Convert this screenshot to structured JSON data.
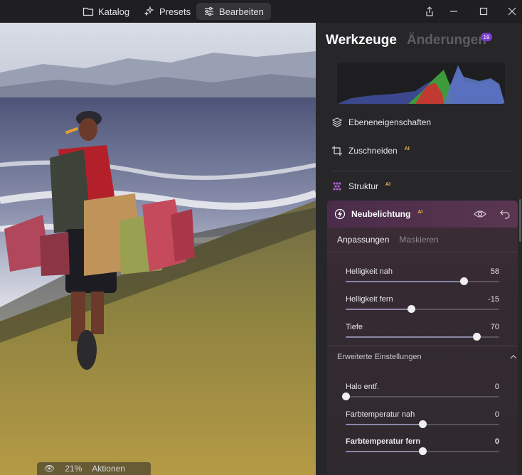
{
  "topbar": {
    "nav": [
      {
        "label": "Katalog",
        "icon": "folder-icon"
      },
      {
        "label": "Presets",
        "icon": "sparkle-icon"
      },
      {
        "label": "Bearbeiten",
        "icon": "sliders-icon"
      }
    ],
    "active": "Bearbeiten"
  },
  "photo_bar": {
    "zoom": "21%",
    "actions": "Aktionen"
  },
  "panel": {
    "tab_tools": "Werkzeuge",
    "tab_changes": "Änderungen",
    "changes_count": "19",
    "tools": [
      {
        "label": "Ebeneneigenschaften",
        "icon": "layers-icon",
        "ai": ""
      },
      {
        "label": "Zuschneiden",
        "icon": "crop-icon",
        "ai": "AI"
      },
      {
        "label": "Struktur",
        "icon": "structure-icon",
        "ai": "AI"
      }
    ],
    "neubelichtung": {
      "title": "Neubelichtung",
      "ai": "AI",
      "subtab_active": "Anpassungen",
      "subtab_inactive": "Maskieren",
      "sliders": [
        {
          "label": "Helligkeit nah",
          "value": "58",
          "level": 0.77
        },
        {
          "label": "Helligkeit fern",
          "value": "-15",
          "level": 0.425
        },
        {
          "label": "Tiefe",
          "value": "70",
          "level": 0.85
        }
      ],
      "advanced_title": "Erweiterte Einstellungen",
      "advanced_sliders": [
        {
          "label": "Halo entf.",
          "value": "0",
          "level": 0.0
        },
        {
          "label": "Farbtemperatur nah",
          "value": "0",
          "level": 0.5
        },
        {
          "label": "Farbtemperatur fern",
          "value": "0",
          "level": 0.5
        }
      ]
    }
  },
  "colors": {
    "accent_purple": "#7a3bd0",
    "ai_gold": "#e7b84a",
    "active_header": "#4a2c4a"
  }
}
